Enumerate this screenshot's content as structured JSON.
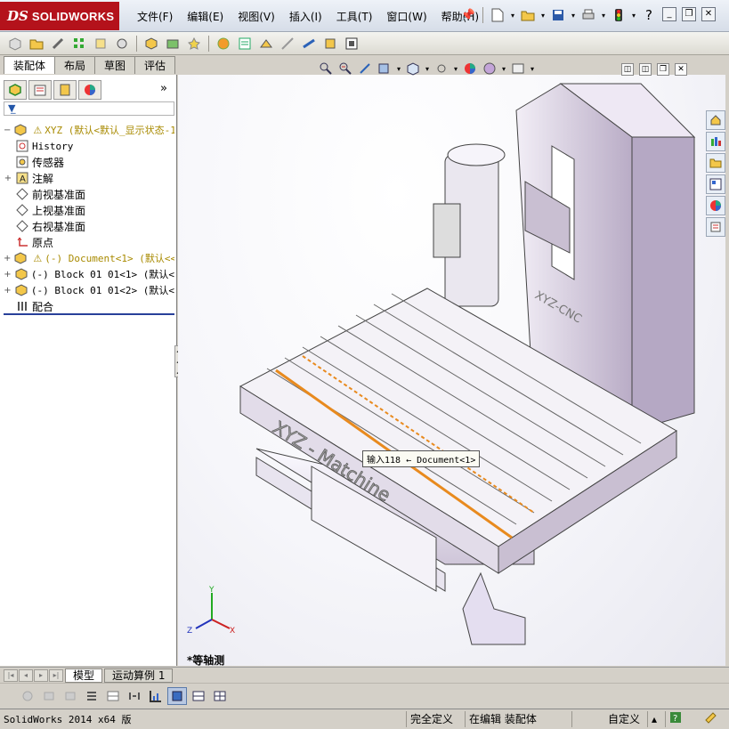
{
  "app": {
    "logo_ds": "DS",
    "logo_name": "SOLIDWORKS"
  },
  "menus": [
    "文件(F)",
    "编辑(E)",
    "视图(V)",
    "插入(I)",
    "工具(T)",
    "窗口(W)",
    "帮助(H)"
  ],
  "window_controls": {
    "minimize": "_",
    "restore": "❐",
    "close": "✕"
  },
  "command_tabs": [
    "装配体",
    "布局",
    "草图",
    "评估"
  ],
  "filter_placeholder": "",
  "tree": {
    "root": "XYZ  (默认<默认_显示状态-1",
    "items": [
      {
        "label": "History",
        "icon": "history-icon"
      },
      {
        "label": "传感器",
        "icon": "sensor-icon"
      },
      {
        "label": "注解",
        "icon": "annotation-icon"
      },
      {
        "label": "前视基准面",
        "icon": "plane-icon"
      },
      {
        "label": "上视基准面",
        "icon": "plane-icon"
      },
      {
        "label": "右视基准面",
        "icon": "plane-icon"
      },
      {
        "label": "原点",
        "icon": "origin-icon"
      },
      {
        "label": "(-) Document<1> (默认<<",
        "icon": "assembly-icon"
      },
      {
        "label": "(-) Block 01 01<1> (默认<",
        "icon": "part-icon"
      },
      {
        "label": "(-) Block 01 01<2> (默认<",
        "icon": "part-icon"
      },
      {
        "label": "配合",
        "icon": "mates-icon"
      }
    ]
  },
  "model": {
    "engraving_front": "XYZ - Matchine",
    "engraving_column": "XYZ-CNC",
    "tooltip": "输入118 ← Document<1>"
  },
  "view_name": "*等轴测",
  "triad": {
    "x": "X",
    "y": "Y",
    "z": "Z"
  },
  "bottom_tabs": [
    "模型",
    "运动算例 1"
  ],
  "status": {
    "app": "SolidWorks 2014 x64 版",
    "defined": "完全定义",
    "mode": "在编辑 装配体",
    "units": "自定义"
  },
  "colors": {
    "accent_orange": "#e88a1e",
    "model_shade": "#c9bfd2",
    "logo_red": "#b4121b"
  }
}
